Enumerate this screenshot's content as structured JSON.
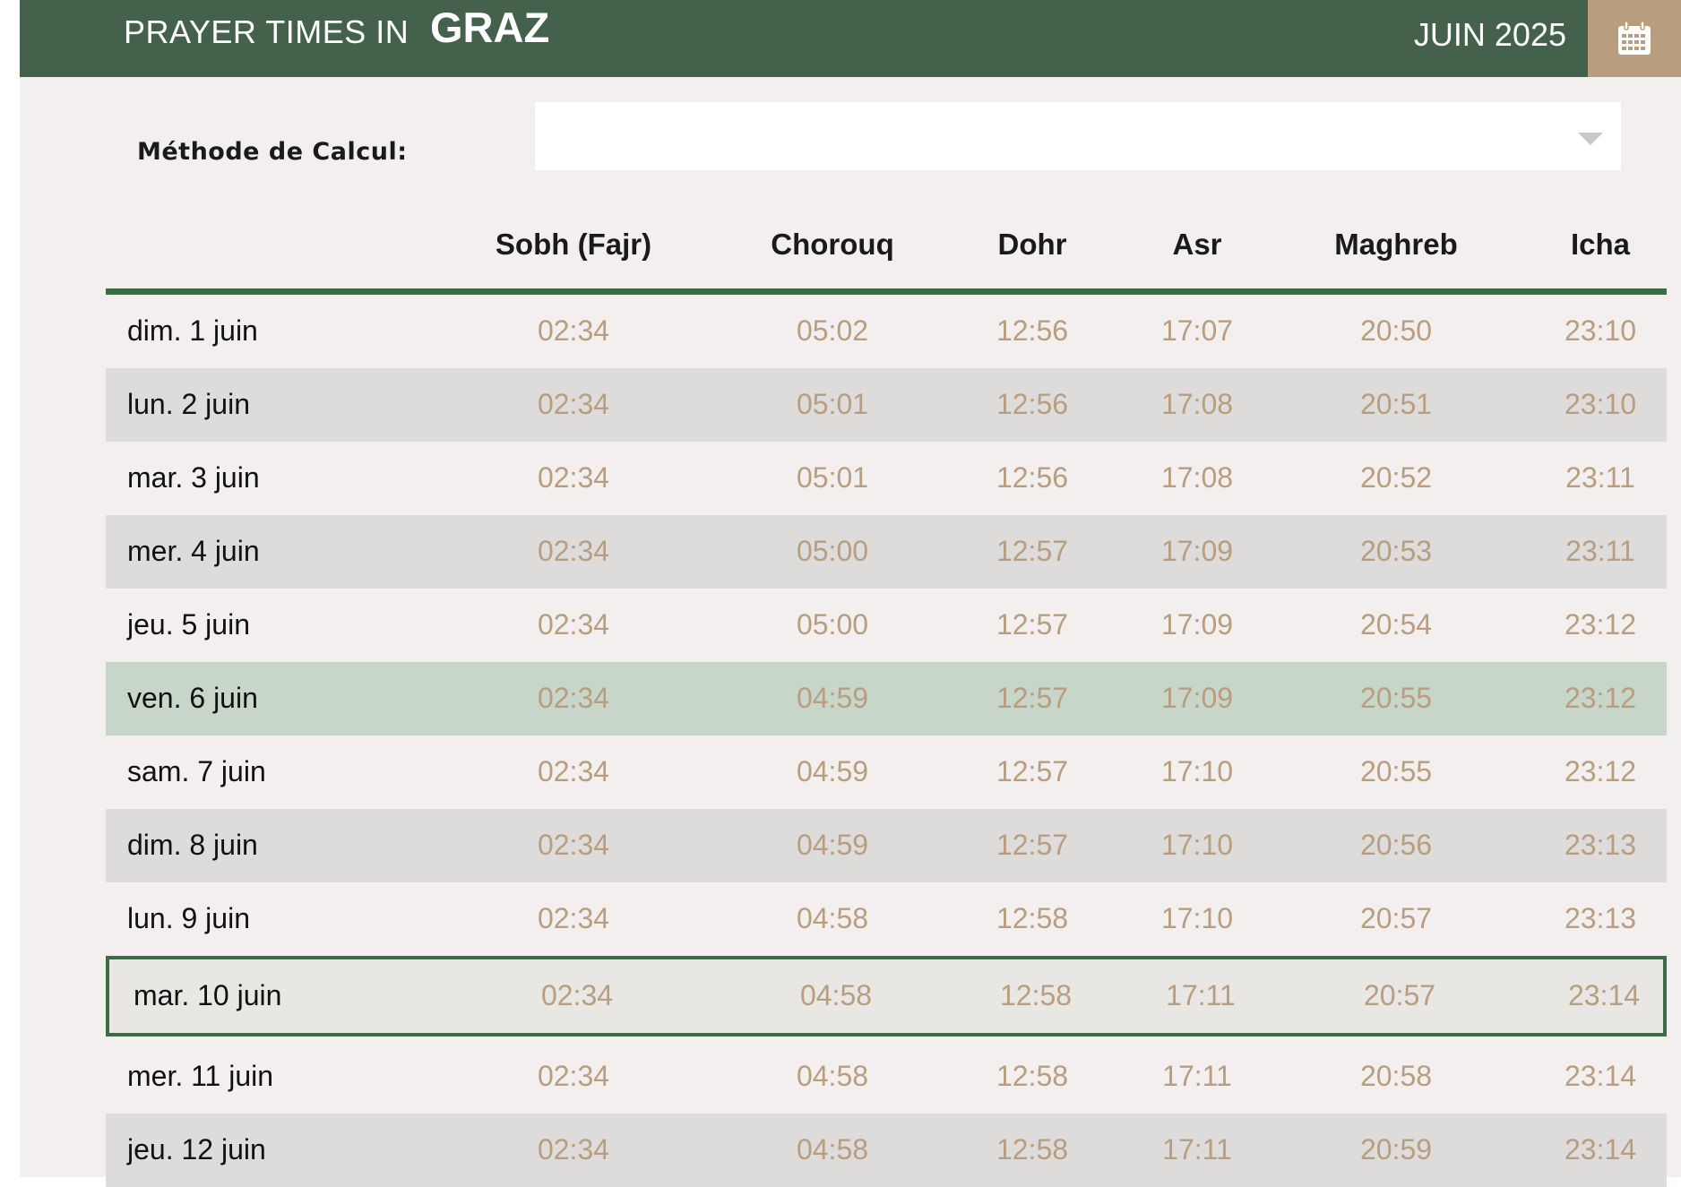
{
  "header": {
    "prefix": "PRAYER TIMES IN",
    "city": "GRAZ",
    "month": "JUIN 2025"
  },
  "icons": {
    "calendar": "calendar-icon",
    "dropdown": "chevron-down-icon"
  },
  "colors": {
    "header_bg": "#44614b",
    "calendar_bg": "#b89e7f",
    "time_text": "#b89e7f",
    "accent_green": "#3d6b44",
    "friday_row": "#c8d5c9"
  },
  "method": {
    "label": "Méthode de Calcul:",
    "selected": ""
  },
  "table": {
    "columns": [
      "",
      "Sobh (Fajr)",
      "Chorouq",
      "Dohr",
      "Asr",
      "Maghreb",
      "Icha"
    ],
    "rows": [
      {
        "date": "dim. 1 juin",
        "times": [
          "02:34",
          "05:02",
          "12:56",
          "17:07",
          "20:50",
          "23:10"
        ],
        "style": "normal"
      },
      {
        "date": "lun. 2 juin",
        "times": [
          "02:34",
          "05:01",
          "12:56",
          "17:08",
          "20:51",
          "23:10"
        ],
        "style": "alt"
      },
      {
        "date": "mar. 3 juin",
        "times": [
          "02:34",
          "05:01",
          "12:56",
          "17:08",
          "20:52",
          "23:11"
        ],
        "style": "normal"
      },
      {
        "date": "mer. 4 juin",
        "times": [
          "02:34",
          "05:00",
          "12:57",
          "17:09",
          "20:53",
          "23:11"
        ],
        "style": "alt"
      },
      {
        "date": "jeu. 5 juin",
        "times": [
          "02:34",
          "05:00",
          "12:57",
          "17:09",
          "20:54",
          "23:12"
        ],
        "style": "normal"
      },
      {
        "date": "ven. 6 juin",
        "times": [
          "02:34",
          "04:59",
          "12:57",
          "17:09",
          "20:55",
          "23:12"
        ],
        "style": "friday"
      },
      {
        "date": "sam. 7 juin",
        "times": [
          "02:34",
          "04:59",
          "12:57",
          "17:10",
          "20:55",
          "23:12"
        ],
        "style": "normal"
      },
      {
        "date": "dim. 8 juin",
        "times": [
          "02:34",
          "04:59",
          "12:57",
          "17:10",
          "20:56",
          "23:13"
        ],
        "style": "alt"
      },
      {
        "date": "lun. 9 juin",
        "times": [
          "02:34",
          "04:58",
          "12:58",
          "17:10",
          "20:57",
          "23:13"
        ],
        "style": "normal"
      },
      {
        "date": "mar. 10 juin",
        "times": [
          "02:34",
          "04:58",
          "12:58",
          "17:11",
          "20:57",
          "23:14"
        ],
        "style": "today"
      },
      {
        "date": "mer. 11 juin",
        "times": [
          "02:34",
          "04:58",
          "12:58",
          "17:11",
          "20:58",
          "23:14"
        ],
        "style": "normal"
      },
      {
        "date": "jeu. 12 juin",
        "times": [
          "02:34",
          "04:58",
          "12:58",
          "17:11",
          "20:59",
          "23:14"
        ],
        "style": "alt"
      }
    ]
  }
}
